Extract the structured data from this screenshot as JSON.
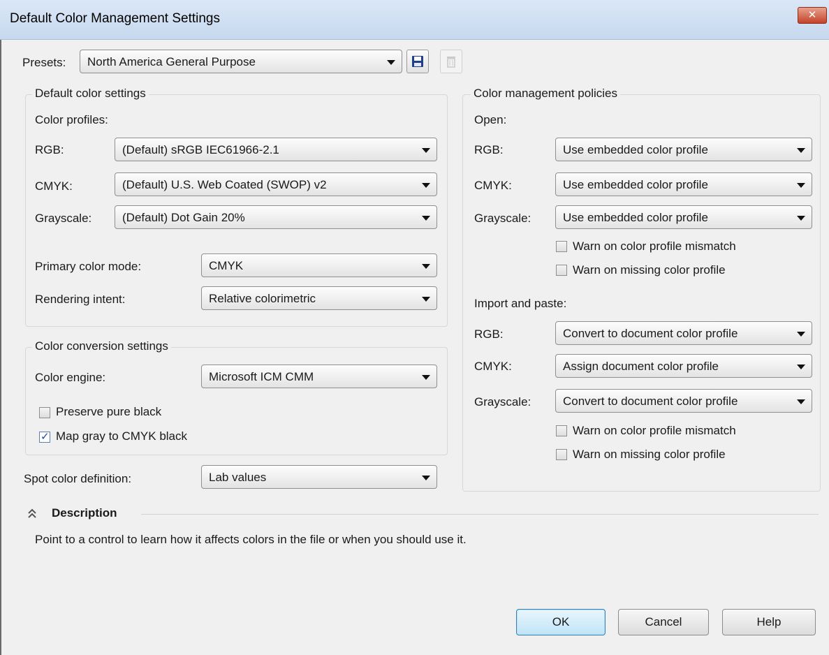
{
  "window": {
    "title": "Default Color Management Settings",
    "close_label": "✕"
  },
  "presets": {
    "label": "Presets:",
    "value": "North America General Purpose",
    "save_icon": "floppy-disk-icon",
    "delete_icon": "trash-icon"
  },
  "default_color_settings": {
    "title": "Default color settings",
    "profiles_label": "Color profiles:",
    "rgb_label": "RGB:",
    "rgb_value": "(Default) sRGB IEC61966-2.1",
    "cmyk_label": "CMYK:",
    "cmyk_value": "(Default) U.S. Web Coated (SWOP) v2",
    "grayscale_label": "Grayscale:",
    "grayscale_value": "(Default) Dot Gain 20%",
    "primary_mode_label": "Primary color mode:",
    "primary_mode_value": "CMYK",
    "rendering_intent_label": "Rendering intent:",
    "rendering_intent_value": "Relative colorimetric"
  },
  "conversion": {
    "title": "Color conversion settings",
    "engine_label": "Color engine:",
    "engine_value": "Microsoft ICM CMM",
    "preserve_black_label": "Preserve pure black",
    "preserve_black_checked": false,
    "map_gray_label": "Map gray to CMYK black",
    "map_gray_checked": true,
    "tick": "✓"
  },
  "spot": {
    "label": "Spot color definition:",
    "value": "Lab values"
  },
  "policies": {
    "title": "Color management policies",
    "open_label": "Open:",
    "open_rgb_label": "RGB:",
    "open_rgb_value": "Use embedded color profile",
    "open_cmyk_label": "CMYK:",
    "open_cmyk_value": "Use embedded color profile",
    "open_gray_label": "Grayscale:",
    "open_gray_value": "Use embedded color profile",
    "open_warn_mismatch": "Warn on color profile mismatch",
    "open_warn_missing": "Warn on missing color profile",
    "import_label": "Import and paste:",
    "import_rgb_label": "RGB:",
    "import_rgb_value": "Convert to document color profile",
    "import_cmyk_label": "CMYK:",
    "import_cmyk_value": "Assign document color profile",
    "import_gray_label": "Grayscale:",
    "import_gray_value": "Convert to document color profile",
    "import_warn_mismatch": "Warn on color profile mismatch",
    "import_warn_missing": "Warn on missing color profile"
  },
  "description": {
    "title": "Description",
    "collapse_icon": "double-chevron-up-icon",
    "text": "Point to a control to learn how it affects colors in the file or when you should use it."
  },
  "buttons": {
    "ok": "OK",
    "cancel": "Cancel",
    "help": "Help"
  }
}
